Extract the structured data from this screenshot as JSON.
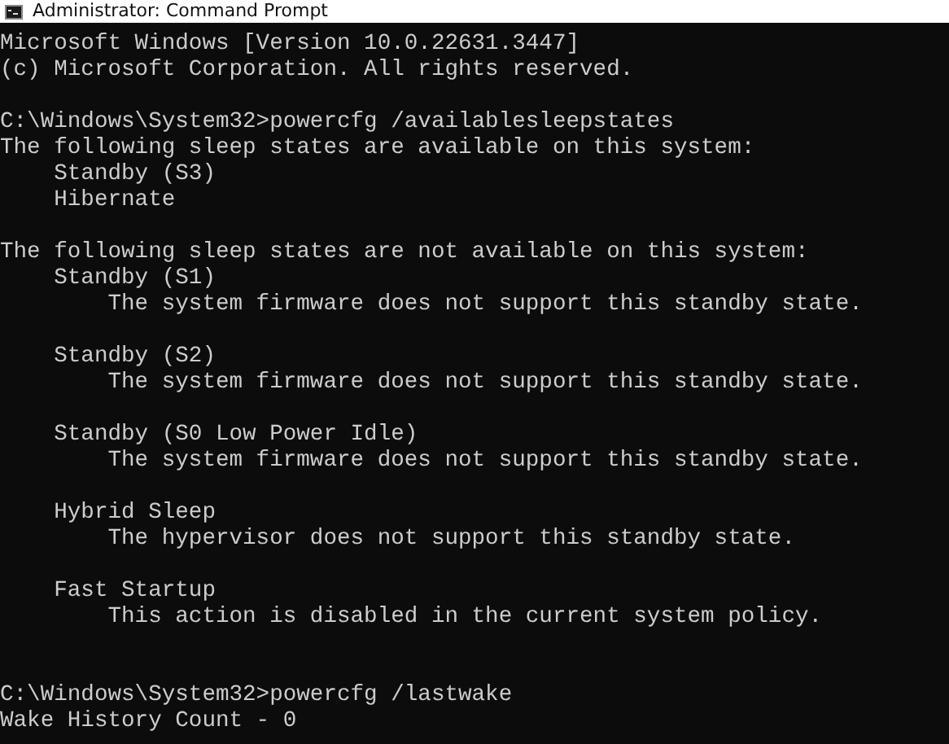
{
  "window": {
    "title": "Administrator: Command Prompt"
  },
  "console": {
    "blocks": [
      {
        "lines": [
          "Microsoft Windows [Version 10.0.22631.3447]",
          "(c) Microsoft Corporation. All rights reserved."
        ]
      },
      {
        "lines": [
          "C:\\Windows\\System32>powercfg /availablesleepstates",
          "The following sleep states are available on this system:",
          "    Standby (S3)",
          "    Hibernate"
        ]
      },
      {
        "lines": [
          "The following sleep states are not available on this system:",
          "    Standby (S1)",
          "        The system firmware does not support this standby state."
        ]
      },
      {
        "lines": [
          "    Standby (S2)",
          "        The system firmware does not support this standby state."
        ]
      },
      {
        "lines": [
          "    Standby (S0 Low Power Idle)",
          "        The system firmware does not support this standby state."
        ]
      },
      {
        "lines": [
          "    Hybrid Sleep",
          "        The hypervisor does not support this standby state."
        ]
      },
      {
        "lines": [
          "    Fast Startup",
          "        This action is disabled in the current system policy."
        ]
      },
      {
        "lines": [
          "C:\\Windows\\System32>powercfg /lastwake",
          "Wake History Count - 0"
        ]
      }
    ]
  }
}
